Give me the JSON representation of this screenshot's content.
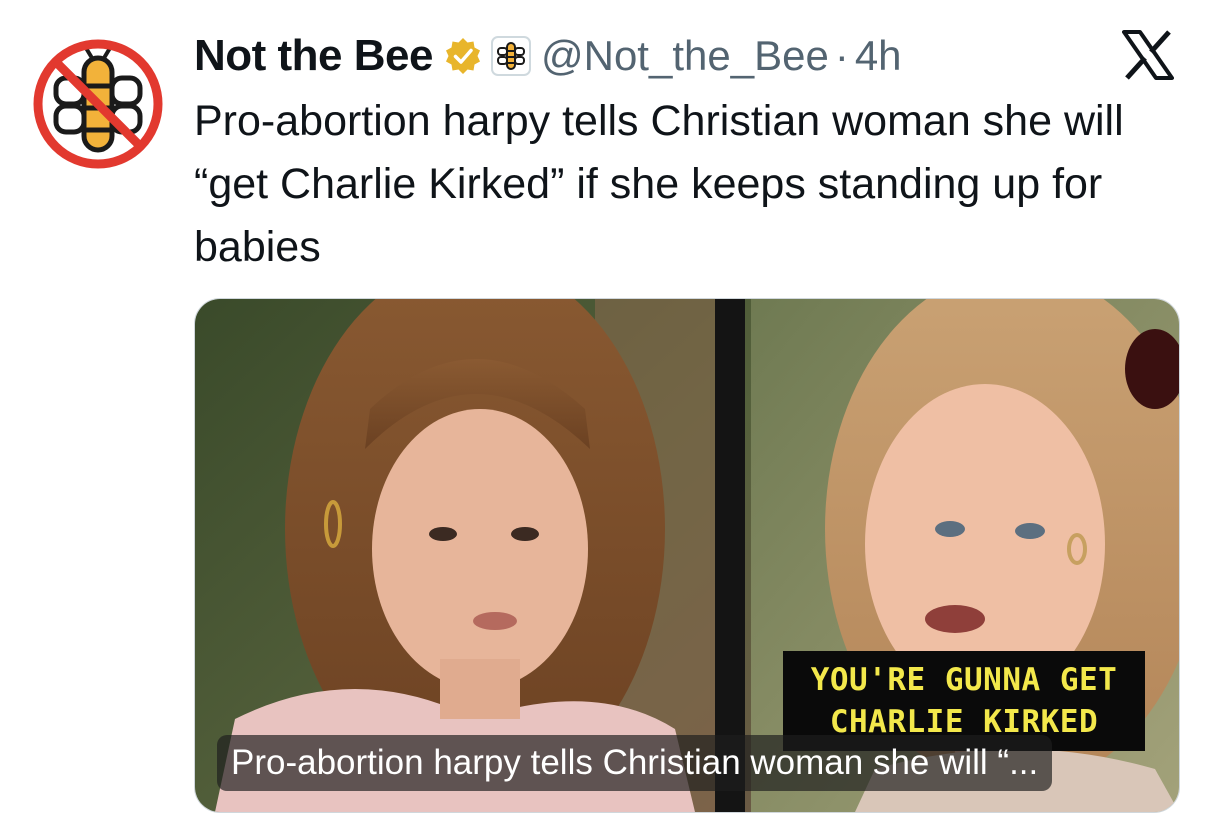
{
  "author": {
    "name": "Not the Bee",
    "handle": "@Not_the_Bee",
    "separator": "·",
    "time": "4h",
    "avatar_icon": "no-bee-logo-icon",
    "verified_icon": "gold-verified-badge-icon",
    "affiliation_icon": "bee-affiliation-badge-icon"
  },
  "platform_icon": "x-logo-icon",
  "tweet": {
    "text": "Pro-abortion harpy tells Christian woman she will “get Charlie Kirked” if she keeps standing up for babies"
  },
  "media": {
    "caption_line1": "YOU'RE GUNNA GET",
    "caption_line2": "CHARLIE KIRKED",
    "title": "Pro-abortion harpy tells Christian woman she will “..."
  },
  "colors": {
    "text": "#0f1419",
    "secondary": "#536471",
    "verified_gold": "#e8b52b",
    "avatar_red": "#e2392f",
    "caption_yellow": "#f3e84b"
  }
}
